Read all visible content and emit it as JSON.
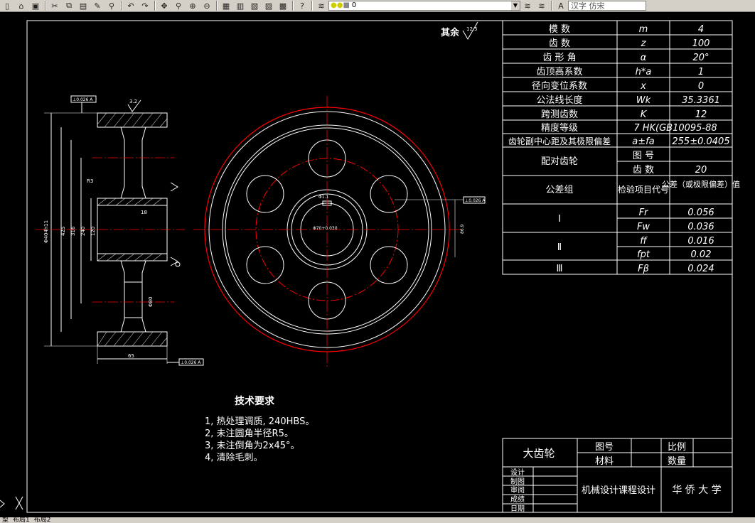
{
  "toolbar": {
    "layer_value": "0",
    "font_value": "汉字 仿宋",
    "icons": [
      "new-icon",
      "open-icon",
      "save-icon",
      "print-icon",
      "cut-icon",
      "copy-icon",
      "paste-icon",
      "brush-icon",
      "match-icon",
      "undo-icon",
      "redo-icon",
      "pan-icon",
      "zoom-icon",
      "zoom-window-icon",
      "zoom-prev-icon",
      "properties-icon",
      "design-center-icon",
      "tool-palette-icon",
      "markup-icon",
      "calculator-icon",
      "help-icon"
    ]
  },
  "drawing": {
    "surface_finish_note": "其余",
    "surface_finish_value": "12.5",
    "datum_left_top": "⊥0.026 A",
    "datum_left_bottom": "⊥0.026 A",
    "datum_right": "⊥0.026 A",
    "dim_outer_dia": "Φ404h11",
    "dim_425": "425",
    "dim_316": "316",
    "dim_240": "240",
    "dim_120": "120",
    "dim_18": "18",
    "dim_width": "65",
    "dim_bore": "Φ70",
    "dim_keyway": "Φ1.1",
    "dim_keyway_right": "86.9",
    "dim_32": "3.2",
    "dim_r3": "R3",
    "hole_dim": "Φ80",
    "center_tol": "Φ70+0.030"
  },
  "param_table": {
    "rows": [
      {
        "name": "模  数",
        "sym": "m",
        "val": "4"
      },
      {
        "name": "齿  数",
        "sym": "z",
        "val": "100"
      },
      {
        "name": "齿 形 角",
        "sym": "α",
        "val": "20°"
      },
      {
        "name": "齿顶高系数",
        "sym": "h*a",
        "val": "1"
      },
      {
        "name": "径向变位系数",
        "sym": "x",
        "val": "0"
      },
      {
        "name": "公法线长度",
        "sym": "Wk",
        "val": "35.3361"
      },
      {
        "name": "跨测齿数",
        "sym": "K",
        "val": "12"
      }
    ],
    "precision_label": "精度等级",
    "precision_value": "7 HK(GB10095-88",
    "center_label": "齿轮副中心距及其极限偏差",
    "center_sym": "a±fa",
    "center_val": "255±0.0405",
    "mate_label": "配对齿轮",
    "mate_drawing": "图  号",
    "mate_teeth": "齿  数",
    "mate_teeth_val": "20",
    "tol_group_label": "公差组",
    "check_item_label": "检验项目代号",
    "tol_value_label": "公差（或极限偏差）值",
    "groups": [
      {
        "group": "Ⅰ",
        "items": [
          {
            "sym": "Fr",
            "val": "0.056"
          },
          {
            "sym": "Fw",
            "val": "0.036"
          }
        ]
      },
      {
        "group": "Ⅱ",
        "items": [
          {
            "sym": "ff",
            "val": "0.016"
          },
          {
            "sym": "fpt",
            "val": "0.02"
          }
        ]
      },
      {
        "group": "Ⅲ",
        "items": [
          {
            "sym": "Fβ",
            "val": "0.024"
          }
        ]
      }
    ]
  },
  "tech_req": {
    "title": "技术要求",
    "lines": [
      "1, 热处理调质, 240HBS。",
      "2, 未注圆角半径R5。",
      "3, 未注倒角为2x45°。",
      "4, 清除毛刺。"
    ]
  },
  "title_block": {
    "part_name": "大齿轮",
    "drawing_no_label": "图号",
    "material_label": "材料",
    "scale_label": "比例",
    "quantity_label": "数量",
    "design_label": "设计",
    "draw_label": "制图",
    "review_label": "审阅",
    "grade_label": "成绩",
    "date_label": "日期",
    "course": "机械设计课程设计",
    "school": "华 侨 大 学"
  },
  "tabs": [
    "型",
    "布局1",
    "布局2"
  ]
}
